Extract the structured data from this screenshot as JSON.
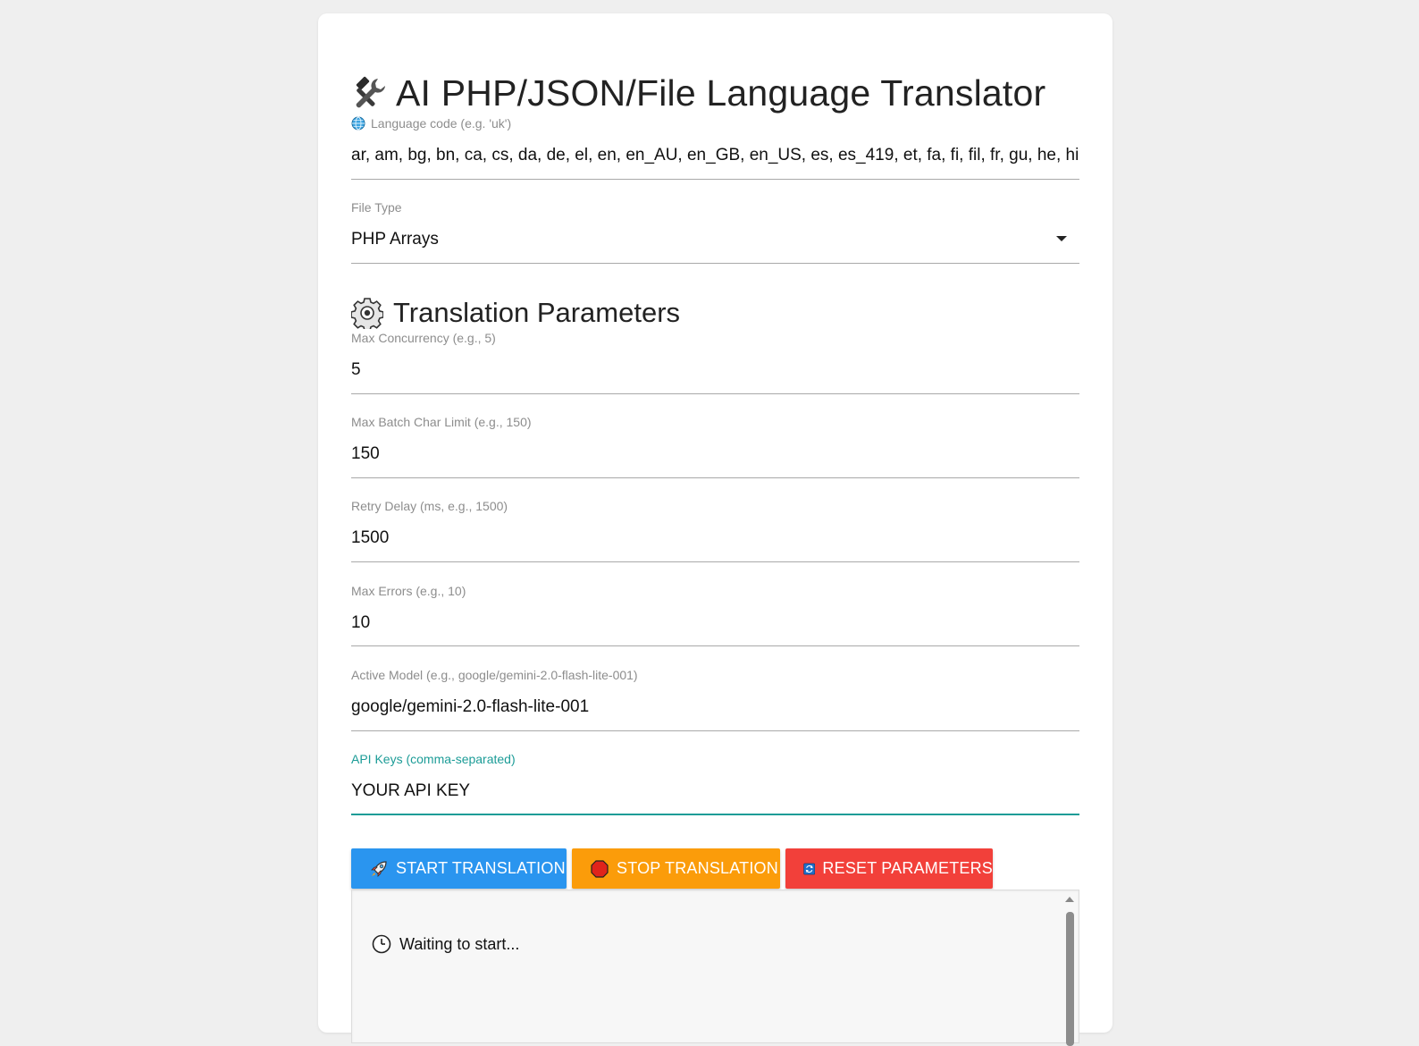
{
  "app": {
    "title": "AI PHP/JSON/File Language Translator",
    "title_icon": "hammer-wrench-icon"
  },
  "language": {
    "label": "Language code (e.g. 'uk')",
    "label_icon": "globe-icon",
    "value": "ar, am, bg, bn, ca, cs, da, de, el, en, en_AU, en_GB, en_US, es, es_419, et, fa, fi, fil, fr, gu, he, hi, h"
  },
  "file_type": {
    "label": "File Type",
    "selected": "PHP Arrays"
  },
  "params_section": {
    "title": "Translation Parameters",
    "icon": "gear-icon"
  },
  "params": {
    "max_concurrency": {
      "label": "Max Concurrency (e.g., 5)",
      "value": "5"
    },
    "max_batch_char_limit": {
      "label": "Max Batch Char Limit (e.g., 150)",
      "value": "150"
    },
    "retry_delay": {
      "label": "Retry Delay (ms, e.g., 1500)",
      "value": "1500"
    },
    "max_errors": {
      "label": "Max Errors (e.g., 10)",
      "value": "10"
    },
    "active_model": {
      "label": "Active Model (e.g., google/gemini-2.0-flash-lite-001)",
      "value": "google/gemini-2.0-flash-lite-001"
    },
    "api_keys": {
      "label": "API Keys (comma-separated)",
      "value": "YOUR API KEY"
    }
  },
  "buttons": {
    "start": {
      "label": "START TRANSLATION",
      "icon": "rocket-icon",
      "color": "#2a95ef"
    },
    "stop": {
      "label": "STOP TRANSLATION",
      "icon": "stop-sign-icon",
      "color": "#fb9c0a"
    },
    "reset": {
      "label": "RESET PARAMETERS",
      "icon": "refresh-icon",
      "color": "#f2403a"
    }
  },
  "log": {
    "status": "Waiting to start...",
    "status_icon": "clock-icon"
  },
  "colors": {
    "accent": "#1c9c97",
    "background": "#efefef",
    "card": "#ffffff"
  }
}
